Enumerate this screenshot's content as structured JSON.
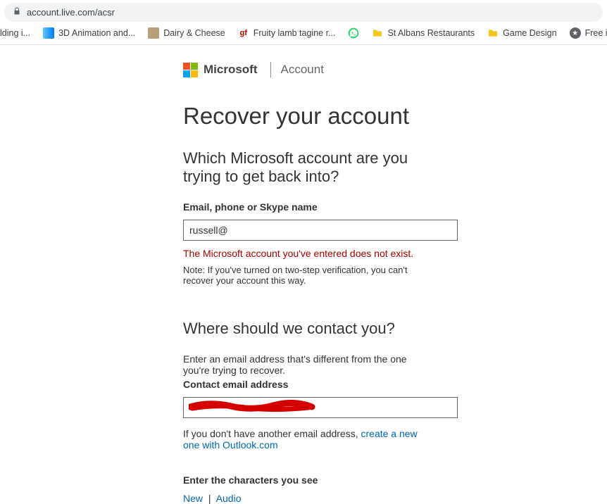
{
  "browser": {
    "url": "account.live.com/acsr",
    "bookmarks": [
      {
        "label": "lding i...",
        "favicon": "none"
      },
      {
        "label": "3D Animation and...",
        "favicon": "blue"
      },
      {
        "label": "Dairy & Cheese",
        "favicon": "tan"
      },
      {
        "label": "Fruity lamb tagine r...",
        "favicon": "gf"
      },
      {
        "label": "",
        "favicon": "whatsapp"
      },
      {
        "label": "St Albans Restaurants",
        "favicon": "folder"
      },
      {
        "label": "Game Design",
        "favicon": "folder"
      },
      {
        "label": "Free icon",
        "favicon": "star"
      }
    ]
  },
  "header": {
    "brand": "Microsoft",
    "section": "Account"
  },
  "page": {
    "title": "Recover your account",
    "section1": {
      "heading": "Which Microsoft account are you trying to get back into?",
      "label": "Email, phone or Skype name",
      "value": "russell@",
      "error": "The Microsoft account you've entered does not exist.",
      "note": "Note: If you've turned on two-step verification, you can't recover your account this way."
    },
    "section2": {
      "heading": "Where should we contact you?",
      "info": "Enter an email address that's different from the one you're trying to recover.",
      "label": "Contact email address",
      "value": "",
      "helper_pre": "If you don't have another email address, ",
      "helper_link": "create a new one with Outlook.com"
    },
    "captcha": {
      "label": "Enter the characters you see",
      "new": "New",
      "audio": "Audio"
    }
  }
}
